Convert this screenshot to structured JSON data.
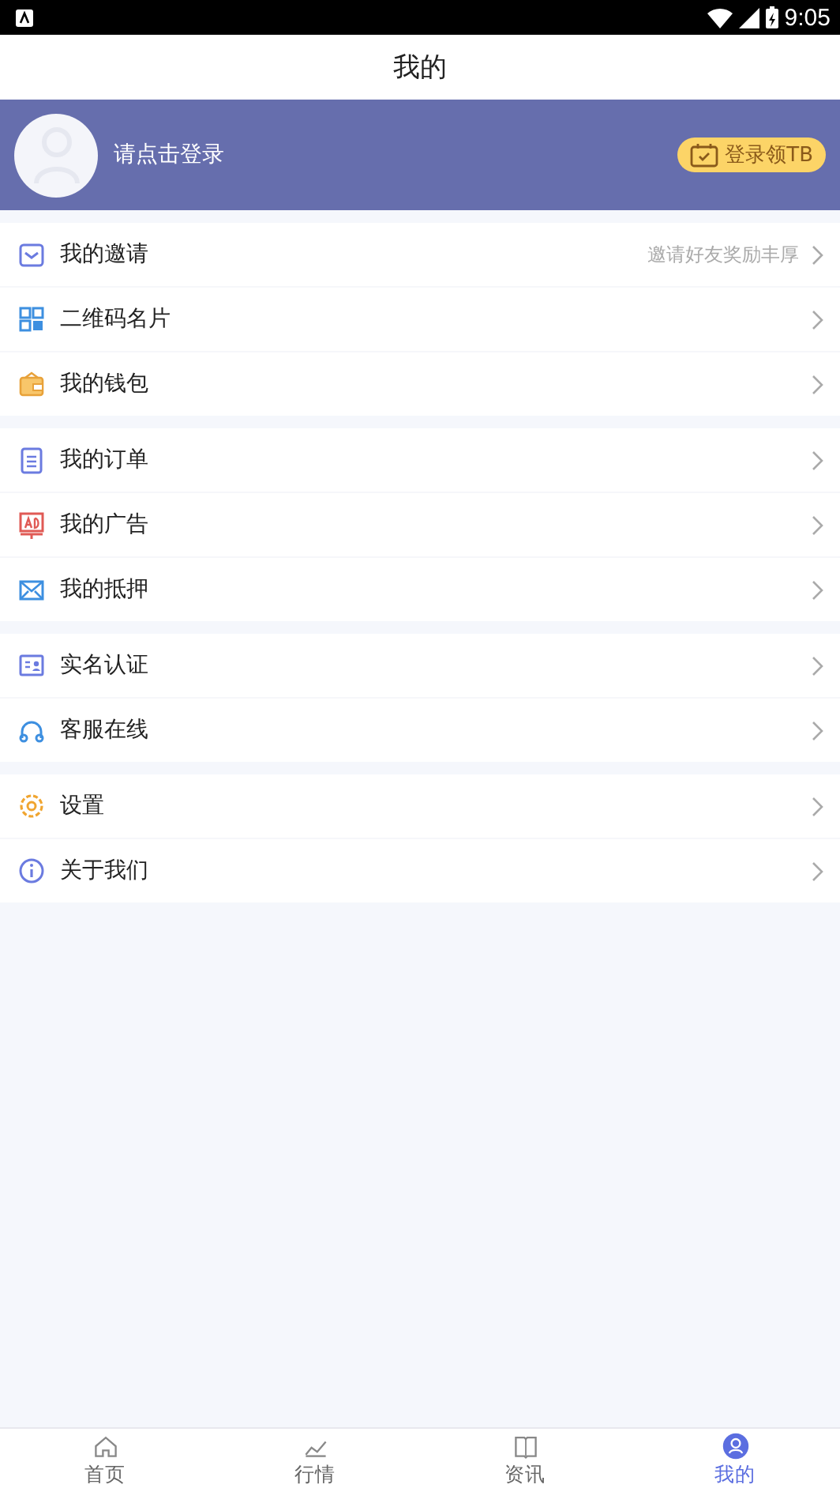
{
  "status_bar": {
    "time": "9:05"
  },
  "header": {
    "title": "我的"
  },
  "profile": {
    "login_prompt": "请点击登录",
    "reward_button": "登录领TB"
  },
  "menu_groups": [
    {
      "items": [
        {
          "label": "我的邀请",
          "hint": "邀请好友奖励丰厚"
        },
        {
          "label": "二维码名片"
        },
        {
          "label": "我的钱包"
        }
      ]
    },
    {
      "items": [
        {
          "label": "我的订单"
        },
        {
          "label": "我的广告"
        },
        {
          "label": "我的抵押"
        }
      ]
    },
    {
      "items": [
        {
          "label": "实名认证"
        },
        {
          "label": "客服在线"
        }
      ]
    },
    {
      "items": [
        {
          "label": "设置"
        },
        {
          "label": "关于我们"
        }
      ]
    }
  ],
  "tab_bar": [
    {
      "label": "首页",
      "selected": false
    },
    {
      "label": "行情",
      "selected": false
    },
    {
      "label": "资讯",
      "selected": false
    },
    {
      "label": "我的",
      "selected": true
    }
  ]
}
